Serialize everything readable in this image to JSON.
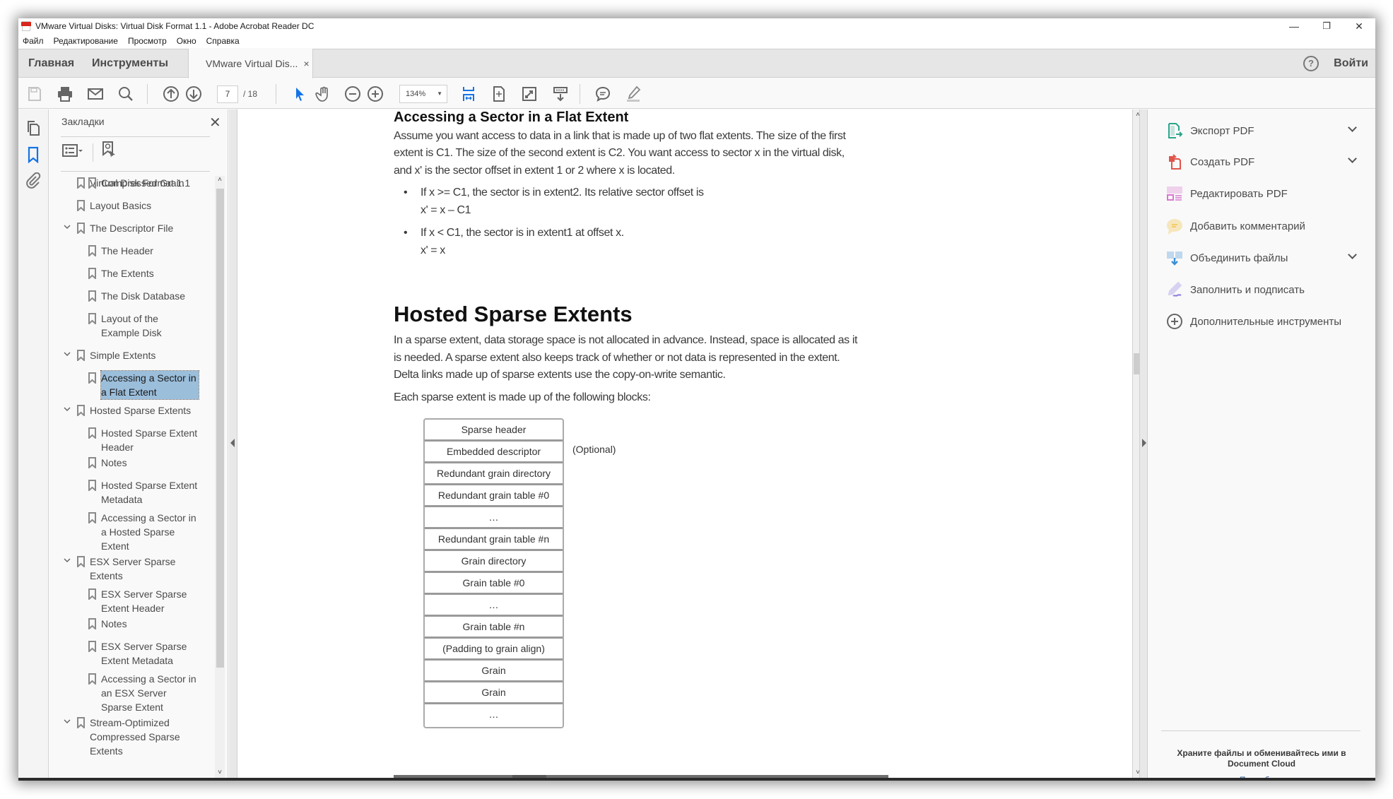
{
  "window": {
    "title": "VMware Virtual Disks: Virtual Disk Format 1.1 - Adobe Acrobat Reader DC",
    "controls": {
      "minimize": "—",
      "restore": "❐",
      "close": "✕"
    }
  },
  "menubar": [
    "Файл",
    "Редактирование",
    "Просмотр",
    "Окно",
    "Справка"
  ],
  "tabs": {
    "home": "Главная",
    "tools": "Инструменты",
    "document": "VMware Virtual Dis...",
    "close": "×",
    "help": "?",
    "signin": "Войти"
  },
  "toolbar": {
    "page_current": "7",
    "page_total": "/  18",
    "zoom": "134%",
    "zoom_caret": "▼",
    "accent_color": "#1473e6"
  },
  "bookmarks": {
    "title": "Закладки",
    "close": "✕",
    "chevron": "⌄",
    "scroll_up": "˄",
    "scroll_down": "˅",
    "items": [
      {
        "label": "Virtual Disk Format 1.1",
        "level": 0,
        "expandable": false
      },
      {
        "label": "Layout Basics",
        "level": 0,
        "expandable": false
      },
      {
        "label": "The Descriptor File",
        "level": 0,
        "expandable": true
      },
      {
        "label": "The Header",
        "level": 1,
        "expandable": false
      },
      {
        "label": "The Extents",
        "level": 1,
        "expandable": false
      },
      {
        "label": "The Disk Database",
        "level": 1,
        "expandable": false
      },
      {
        "label": "Layout of the Example Disk",
        "level": 1,
        "expandable": false
      },
      {
        "label": "Simple Extents",
        "level": 0,
        "expandable": true
      },
      {
        "label": "Accessing a Sector in a Flat Extent",
        "level": 1,
        "expandable": false,
        "selected": true
      },
      {
        "label": "Hosted Sparse Extents",
        "level": 0,
        "expandable": true
      },
      {
        "label": "Hosted Sparse Extent Header",
        "level": 1,
        "expandable": false
      },
      {
        "label": "Notes",
        "level": 1,
        "expandable": false
      },
      {
        "label": "Hosted Sparse Extent Metadata",
        "level": 1,
        "expandable": false
      },
      {
        "label": "Accessing a Sector in a Hosted Sparse Extent",
        "level": 1,
        "expandable": false
      },
      {
        "label": "ESX Server Sparse Extents",
        "level": 0,
        "expandable": true
      },
      {
        "label": "ESX Server Sparse Extent Header",
        "level": 1,
        "expandable": false
      },
      {
        "label": "Notes",
        "level": 1,
        "expandable": false
      },
      {
        "label": "ESX Server Sparse Extent Metadata",
        "level": 1,
        "expandable": false
      },
      {
        "label": "Accessing a Sector in an ESX Server Sparse Extent",
        "level": 1,
        "expandable": false
      },
      {
        "label": "Stream-Optimized Compressed Sparse Extents",
        "level": 0,
        "expandable": true
      },
      {
        "label": "Compressed Grain",
        "level": 1,
        "expandable": false
      }
    ]
  },
  "document": {
    "section1": {
      "title": "Accessing a Sector in a Flat Extent",
      "lines": [
        "Assume you want access to data in a link that is made up of two flat extents. The size of the first",
        "extent is C1. The size of the second extent is C2. You want access to sector x in the virtual disk,",
        "and x' is the sector offset in extent 1 or 2 where x is located."
      ],
      "bullets": [
        {
          "line1": "If x >= C1, the sector is in extent2. Its relative sector offset is",
          "line2": "x' = x – C1"
        },
        {
          "line1": "If x < C1, the sector is in extent1 at offset x.",
          "line2": "x' = x"
        }
      ]
    },
    "section2": {
      "title": "Hosted Sparse Extents",
      "lines": [
        "In a sparse extent, data storage space is not allocated in advance. Instead, space is allocated as it",
        "is needed. A sparse extent also keeps track of whether or not data is represented in the extent.",
        "Delta links made up of sparse extents use the copy-on-write semantic."
      ],
      "blocks_intro": "Each sparse extent is made up of the following blocks:",
      "blocks": [
        "Sparse header",
        "Embedded descriptor",
        "Redundant grain directory",
        "Redundant grain table #0",
        "…",
        "Redundant grain table #n",
        "Grain directory",
        "Grain table #0",
        "…",
        "Grain table #n",
        "(Padding to grain align)",
        "Grain",
        "Grain",
        "…"
      ],
      "optional_note": "(Optional)"
    }
  },
  "tools_panel": {
    "items": [
      {
        "label": "Экспорт PDF",
        "icon": "export-pdf-icon",
        "color": "#2aa58a",
        "expandable": true
      },
      {
        "label": "Создать PDF",
        "icon": "create-pdf-icon",
        "color": "#e0554a",
        "expandable": true
      },
      {
        "label": "Редактировать PDF",
        "icon": "edit-pdf-icon",
        "color": "#d977d1",
        "expandable": false
      },
      {
        "label": "Добавить комментарий",
        "icon": "comment-icon",
        "color": "#f3c34c",
        "expandable": false
      },
      {
        "label": "Объединить файлы",
        "icon": "combine-files-icon",
        "color": "#3c8fd6",
        "expandable": true
      },
      {
        "label": "Заполнить и подписать",
        "icon": "fill-sign-icon",
        "color": "#8a7be0",
        "expandable": false
      },
      {
        "label": "Дополнительные инструменты",
        "icon": "more-tools-icon",
        "color": "#666666",
        "expandable": false
      }
    ],
    "promo_text": "Храните файлы и обменивайтесь ими в Document Cloud",
    "promo_link": "Подробнее"
  }
}
